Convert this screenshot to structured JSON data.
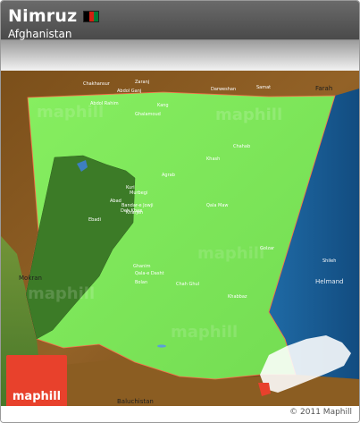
{
  "header": {
    "title": "Nimruz",
    "subtitle": "Afghanistan"
  },
  "colors": {
    "province_green": "#7ee85a",
    "district_dark": "#3c7b27",
    "terrain_brown": "#8a5a1d",
    "water_blue": "#1a5f9a",
    "logo_red": "#e8412c",
    "header_dark": "#4a4a4a"
  },
  "flag_colors": [
    "#000000",
    "#d32011",
    "#007a36"
  ],
  "map": {
    "regions": {
      "farah": "Farah",
      "helmand": "Helmand",
      "baluchistan": "Baluchistan",
      "mokran": "Mokran"
    },
    "places": [
      "Chakhansur",
      "Zaranj",
      "Abdol Ganj",
      "Abdol Rahim",
      "Kang",
      "Darweshan",
      "Samat",
      "Ghalamoud",
      "Chahab",
      "Khash",
      "Agrab",
      "Kuri",
      "Murbegi",
      "Abad",
      "Bandar-e Jowji",
      "Deh Khan",
      "Ebadi",
      "Kharjeh",
      "Qala Maw",
      "Ghanim",
      "Qala-e Dasht",
      "Bolan",
      "Chah Ghul",
      "Khabbaz",
      "Golzar",
      "Shileh"
    ]
  },
  "watermark": "maphill",
  "logo": {
    "text": "maphill"
  },
  "footer": {
    "copyright": "© 2011 Maphill"
  }
}
